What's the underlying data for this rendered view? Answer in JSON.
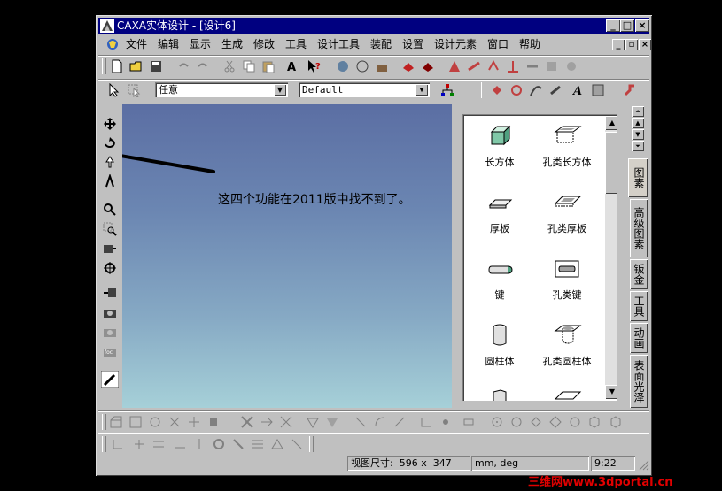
{
  "window": {
    "title": "CAXA实体设计 - [设计6]"
  },
  "menu": [
    "文件",
    "编辑",
    "显示",
    "生成",
    "修改",
    "工具",
    "设计工具",
    "装配",
    "设置",
    "设计元素",
    "窗口",
    "帮助"
  ],
  "toolbar2": {
    "select1_value": "任意",
    "select2_value": "Default"
  },
  "viewport": {
    "note": "这四个功能在2011版中找不到了。"
  },
  "catalog": {
    "items": [
      {
        "label": "长方体",
        "icon": "block-icon"
      },
      {
        "label": "孔类长方体",
        "icon": "hole-block-icon"
      },
      {
        "label": "厚板",
        "icon": "thick-plate-icon"
      },
      {
        "label": "孔类厚板",
        "icon": "hole-thick-plate-icon"
      },
      {
        "label": "键",
        "icon": "key-icon"
      },
      {
        "label": "孔类键",
        "icon": "hole-key-icon"
      },
      {
        "label": "圆柱体",
        "icon": "cylinder-icon"
      },
      {
        "label": "孔类圆柱体",
        "icon": "hole-cylinder-icon"
      }
    ]
  },
  "tabs": [
    "图素",
    "高级图素",
    "钣金",
    "工具",
    "动画",
    "表面光泽"
  ],
  "status": {
    "view_size": "视图尺寸:  596 x  347",
    "units": "mm, deg",
    "time": "9:22"
  },
  "watermark": "三维网www.3dportal.cn",
  "colors": {
    "titlebar": "#000080",
    "face": "#c0c0c0",
    "watermark": "#e00000"
  }
}
